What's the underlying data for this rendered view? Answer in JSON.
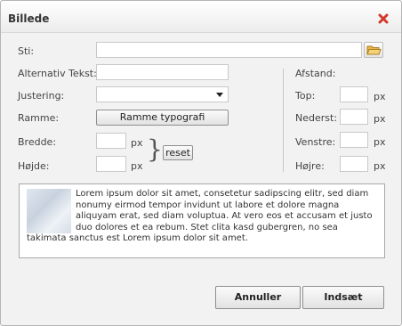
{
  "dialog": {
    "title": "Billede",
    "close_icon": "close-icon"
  },
  "form": {
    "path_label": "Sti:",
    "path_value": "",
    "alt_label": "Alternativ Tekst:",
    "alt_value": "",
    "align_label": "Justering:",
    "align_value": "",
    "frame_label": "Ramme:",
    "frame_button": "Ramme typografi",
    "width_label": "Bredde:",
    "width_value": "",
    "height_label": "Højde:",
    "height_value": "",
    "unit": "px",
    "reset_button": "reset"
  },
  "spacing": {
    "heading": "Afstand:",
    "top_label": "Top:",
    "bottom_label": "Nederst:",
    "left_label": "Venstre:",
    "right_label": "Højre:",
    "unit": "px"
  },
  "preview": {
    "text": "Lorem ipsum dolor sit amet, consetetur sadipscing elitr, sed diam nonumy eirmod tempor invidunt ut labore et dolore magna aliquyam erat, sed diam voluptua. At vero eos et accusam et justo duo dolores et ea rebum. Stet clita kasd gubergren, no sea takimata sanctus est Lorem ipsum dolor sit amet."
  },
  "footer": {
    "cancel_button": "Annuller",
    "insert_button": "Indsæt"
  },
  "colors": {
    "close_icon": "#d33a2c",
    "folder_icon": "#e8b84a"
  }
}
